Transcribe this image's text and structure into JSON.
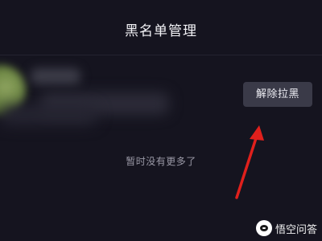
{
  "header": {
    "title": "黑名单管理"
  },
  "blocked_user": {
    "action_label": "解除拉黑"
  },
  "list": {
    "empty_text": "暂时没有更多了"
  },
  "watermark": {
    "text": "悟空问答"
  },
  "colors": {
    "background": "#15141f",
    "button_bg": "#3a3a48",
    "arrow": "#e0201c"
  }
}
